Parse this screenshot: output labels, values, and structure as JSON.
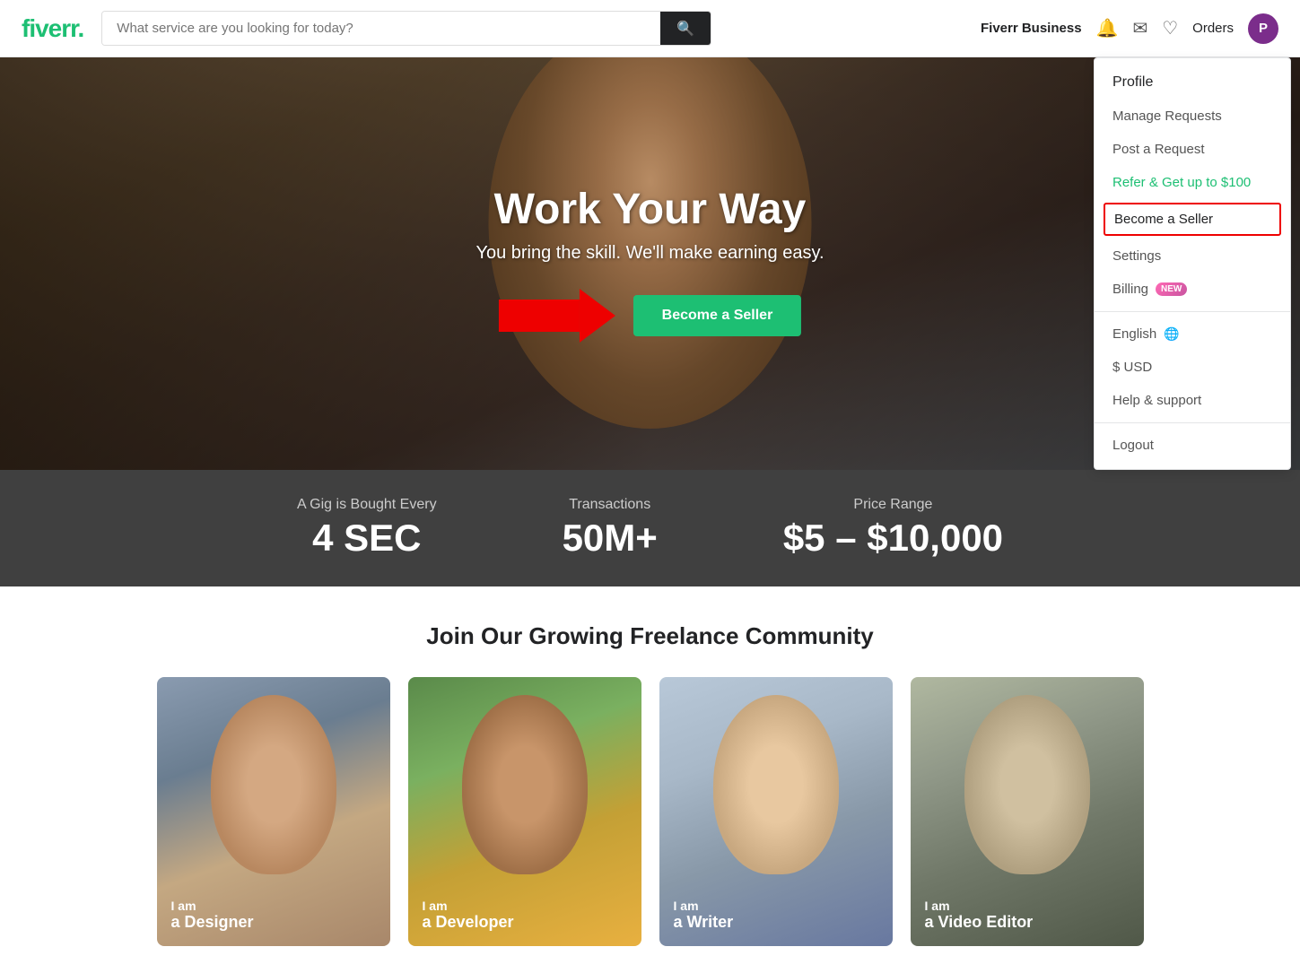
{
  "header": {
    "logo": "fiverr",
    "logo_dot": ".",
    "search_placeholder": "What service are you looking for today?",
    "fiverr_business_label": "Fiverr Business",
    "orders_label": "Orders",
    "avatar_letter": "P"
  },
  "dropdown": {
    "profile_label": "Profile",
    "manage_requests_label": "Manage Requests",
    "post_request_label": "Post a Request",
    "refer_label": "Refer & Get up to $100",
    "become_seller_label": "Become a Seller",
    "settings_label": "Settings",
    "billing_label": "Billing",
    "billing_badge": "NEW",
    "english_label": "English",
    "usd_label": "$ USD",
    "help_label": "Help & support",
    "logout_label": "Logout"
  },
  "hero": {
    "title": "Work Your Way",
    "subtitle": "You bring the skill. We'll make earning easy.",
    "cta_label": "Become a Seller"
  },
  "stats": [
    {
      "label": "A Gig is Bought Every",
      "value": "4 SEC"
    },
    {
      "label": "Transactions",
      "value": "50M+"
    },
    {
      "label": "Price Range",
      "value": "$5 – $10,000"
    }
  ],
  "community": {
    "title": "Join Our Growing Freelance Community",
    "cards": [
      {
        "top": "I am",
        "bottom": "a Designer",
        "bg": "card-bg-1"
      },
      {
        "top": "I am",
        "bottom": "a Developer",
        "bg": "card-bg-2"
      },
      {
        "top": "I am",
        "bottom": "a Writer",
        "bg": "card-bg-3"
      },
      {
        "top": "I am",
        "bottom": "a Video Editor",
        "bg": "card-bg-4"
      }
    ]
  }
}
